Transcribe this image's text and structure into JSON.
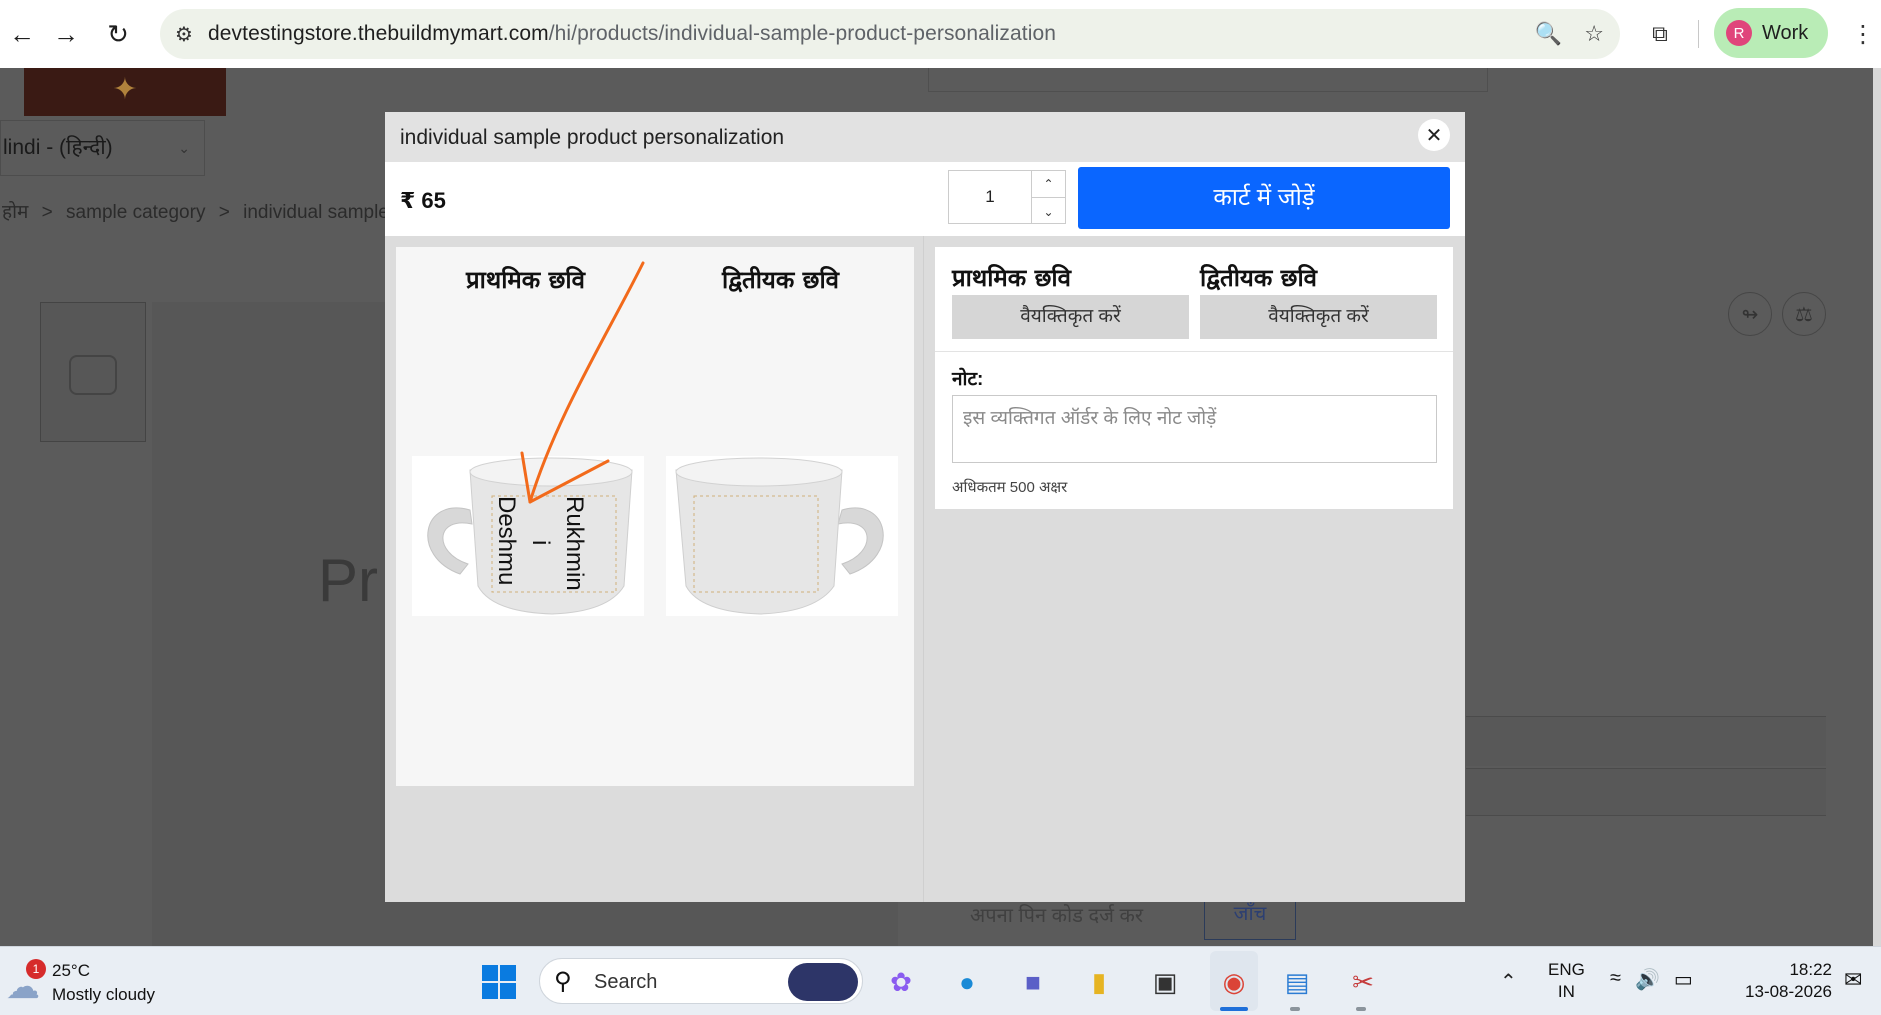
{
  "browser": {
    "url_domain": "devtestingstore.thebuildmymart.com",
    "url_path": "/hi/products/individual-sample-product-personalization",
    "profile_initial": "R",
    "profile_name": "Work"
  },
  "background_page": {
    "language_selector": "lindi - (हिन्दी)",
    "breadcrumb": [
      "होम",
      ">",
      "sample category",
      ">",
      "individual sample"
    ],
    "large_text": "Pr",
    "pincode_placeholder": "अपना पिन कोड दर्ज कर",
    "pincode_button": "जाँच"
  },
  "modal": {
    "title": "individual sample product personalization",
    "price": "₹ 65",
    "quantity": "1",
    "add_to_cart": "कार्ट में जोड़ें",
    "preview": {
      "primary_label": "प्राथमिक छवि",
      "secondary_label": "द्वितीयक छवि",
      "custom_text_line1": "Rukhmin",
      "custom_text_line2": "i",
      "custom_text_line3": "Deshmu"
    },
    "form": {
      "primary_label": "प्राथमिक छवि",
      "secondary_label": "द्वितीयक छवि",
      "personalize_button": "वैयक्तिकृत करें",
      "note_label": "नोट:",
      "note_placeholder": "इस व्यक्तिगत ऑर्डर के लिए नोट जोड़ें",
      "note_hint": "अधिकतम 500 अक्षर"
    }
  },
  "taskbar": {
    "weather_badge": "1",
    "temperature": "25°C",
    "condition": "Mostly cloudy",
    "search_label": "Search",
    "lang_line1": "ENG",
    "lang_line2": "IN",
    "time": "18:22",
    "date": "13-08-2026"
  },
  "colors": {
    "accent_button": "#0a66ff",
    "annotation_arrow": "#f26a1b",
    "profile_pill": "#b9ecb6"
  }
}
